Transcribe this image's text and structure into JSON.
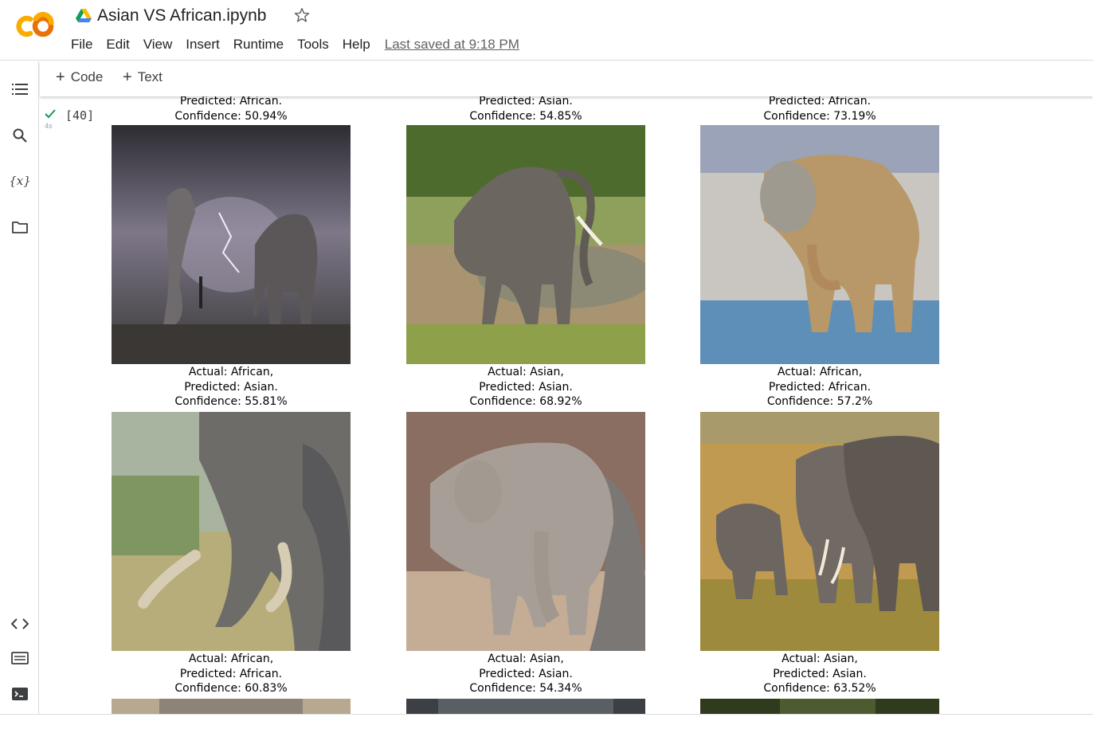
{
  "app": {
    "logo_text": "CO",
    "title": "Asian VS African.ipynb",
    "menu": [
      "File",
      "Edit",
      "View",
      "Insert",
      "Runtime",
      "Tools",
      "Help"
    ],
    "last_saved": "Last saved at 9:18 PM"
  },
  "toolbar": {
    "code_label": "Code",
    "text_label": "Text"
  },
  "rail": {
    "variables_label": "{x}"
  },
  "cell": {
    "exec_count": "[40]",
    "exec_time": "4s"
  },
  "output": {
    "row0_partial": [
      {
        "predicted": "Predicted: African.",
        "confidence": "Confidence: 50.94%"
      },
      {
        "predicted": "Predicted: Asian.",
        "confidence": "Confidence: 54.85%"
      },
      {
        "predicted": "Predicted: African.",
        "confidence": "Confidence: 73.19%"
      }
    ],
    "row1_labels": [
      {
        "actual": "Actual: African,",
        "predicted": "Predicted: Asian.",
        "confidence": "Confidence: 55.81%"
      },
      {
        "actual": "Actual: Asian,",
        "predicted": "Predicted: Asian.",
        "confidence": "Confidence: 68.92%"
      },
      {
        "actual": "Actual: African,",
        "predicted": "Predicted: African.",
        "confidence": "Confidence: 57.2%"
      }
    ],
    "row2_labels": [
      {
        "actual": "Actual: African,",
        "predicted": "Predicted: African.",
        "confidence": "Confidence: 60.83%"
      },
      {
        "actual": "Actual: Asian,",
        "predicted": "Predicted: Asian.",
        "confidence": "Confidence: 54.34%"
      },
      {
        "actual": "Actual: Asian,",
        "predicted": "Predicted: Asian.",
        "confidence": "Confidence: 63.52%"
      }
    ]
  },
  "colors": {
    "logo_orange": "#f9ab00",
    "logo_deep": "#e8710a",
    "check_green": "#0f9d58",
    "menu_text": "#202124",
    "muted": "#5f6368"
  }
}
